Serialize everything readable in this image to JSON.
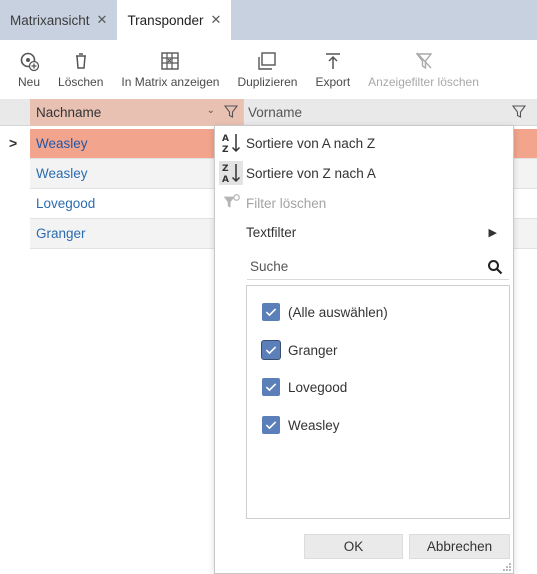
{
  "tabs": [
    {
      "label": "Matrixansicht",
      "active": false
    },
    {
      "label": "Transponder",
      "active": true
    }
  ],
  "toolbar": {
    "neu": "Neu",
    "loeschen": "Löschen",
    "in_matrix": "In Matrix anzeigen",
    "duplizieren": "Duplizieren",
    "export": "Export",
    "anzeigefilter_loeschen": "Anzeigefilter löschen"
  },
  "grid": {
    "columns": [
      "Nachname",
      "Vorname"
    ],
    "rows": [
      "Weasley",
      "Weasley",
      "Lovegood",
      "Granger"
    ],
    "row_indicator": ">"
  },
  "popup": {
    "sort_asc": "Sortiere von A nach Z",
    "sort_desc": "Sortiere von Z nach A",
    "filter_clear": "Filter löschen",
    "textfilter": "Textfilter",
    "search_placeholder": "Suche",
    "items": [
      "(Alle auswählen)",
      "Granger",
      "Lovegood",
      "Weasley"
    ],
    "ok": "OK",
    "cancel": "Abbrechen"
  },
  "colors": {
    "tabbar": "#c8d1e0",
    "selected_row": "#f2a48c",
    "sorted_header": "#e8c1b2",
    "checkbox": "#5b7fb8",
    "link_text": "#2b6cb0"
  }
}
